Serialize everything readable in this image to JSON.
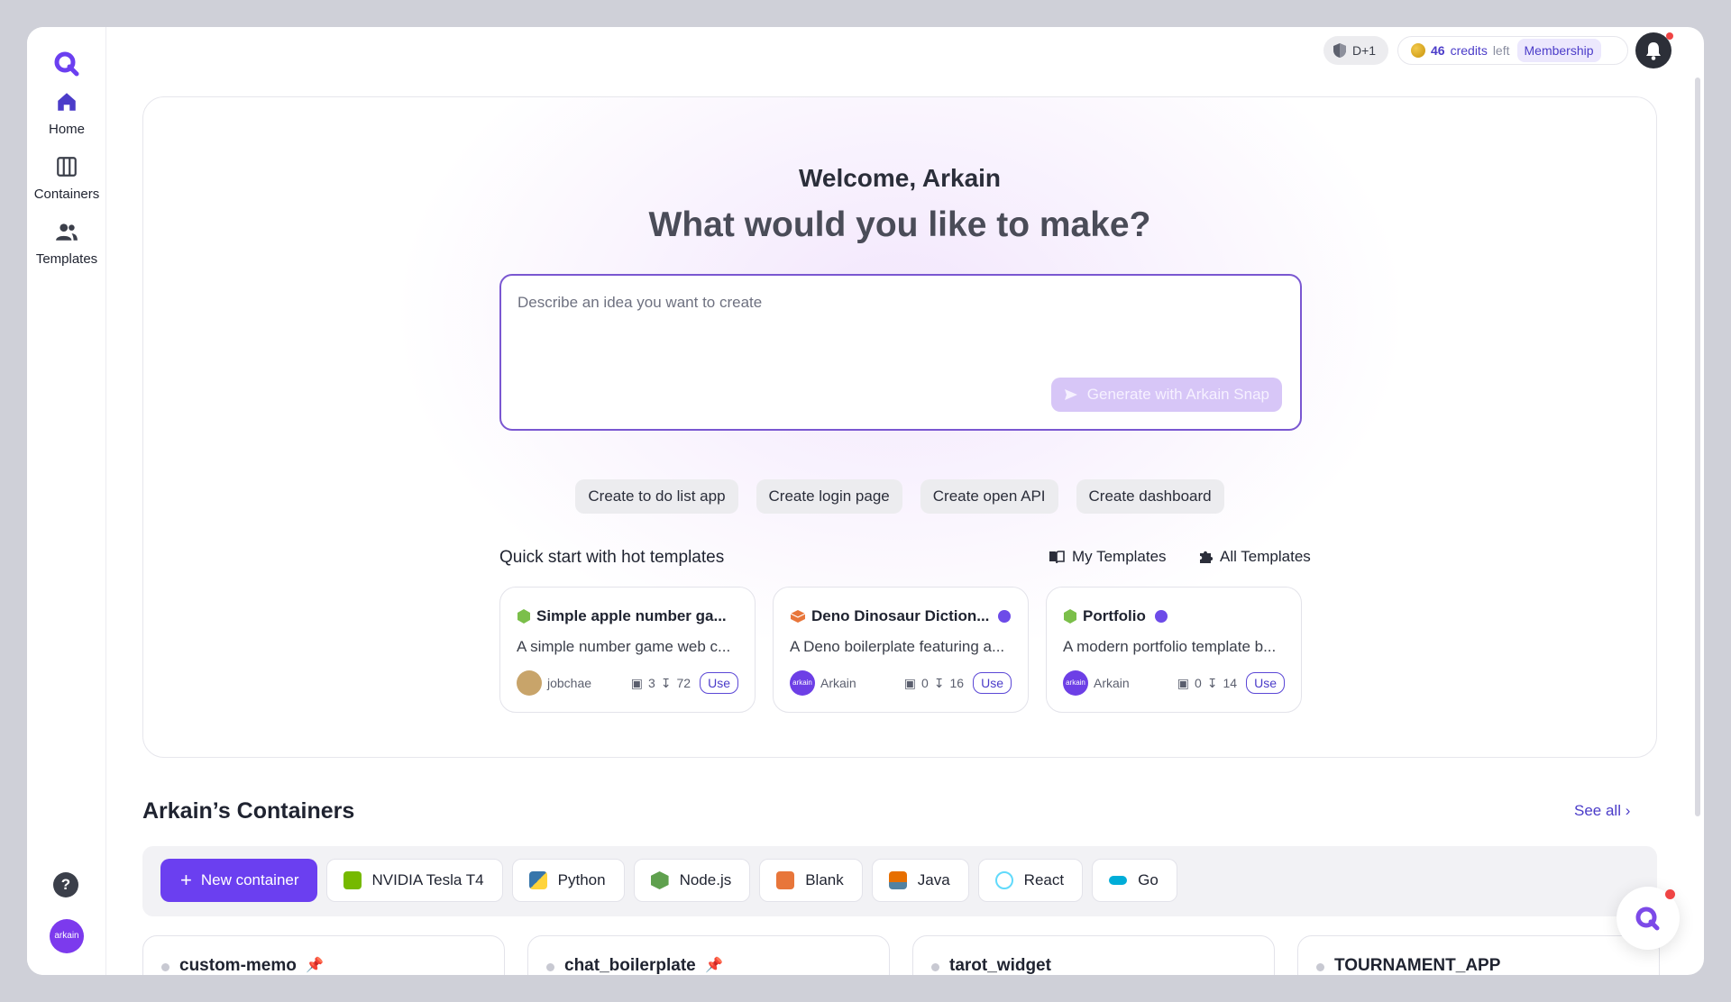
{
  "sidebar": {
    "items": [
      {
        "label": "Home",
        "icon": "home-icon"
      },
      {
        "label": "Containers",
        "icon": "containers-icon"
      },
      {
        "label": "Templates",
        "icon": "users-icon"
      }
    ],
    "help_icon": "question-icon",
    "avatar_text": "arkain"
  },
  "topbar": {
    "rank": "D+1",
    "credits_num": "46",
    "credits_word": "credits",
    "credits_left": "left",
    "membership": "Membership"
  },
  "hero": {
    "welcome": "Welcome, Arkain",
    "question": "What would you like to make?",
    "placeholder": "Describe an idea you want to create",
    "generate": "Generate with Arkain Snap",
    "chips": [
      "Create to do list app",
      "Create login page",
      "Create open API",
      "Create dashboard"
    ]
  },
  "quickstart": {
    "title": "Quick start with hot templates",
    "my_templates": "My Templates",
    "all_templates": "All Templates",
    "cards": [
      {
        "title": "Simple apple number ga...",
        "desc": "A simple number game web c...",
        "author": "jobchae",
        "comments": "3",
        "downloads": "72",
        "use": "Use",
        "verified": false,
        "icon_color": "#7bbf4a",
        "avatar_color": "#c8a46a",
        "avatar_text": ""
      },
      {
        "title": "Deno Dinosaur Diction...",
        "desc": "A Deno boilerplate featuring a...",
        "author": "Arkain",
        "comments": "0",
        "downloads": "16",
        "use": "Use",
        "verified": true,
        "icon_color": "#e8763a",
        "avatar_color": "#6d3fe6",
        "avatar_text": "arkain"
      },
      {
        "title": "Portfolio",
        "desc": "A modern portfolio template b...",
        "author": "Arkain",
        "comments": "0",
        "downloads": "14",
        "use": "Use",
        "verified": true,
        "icon_color": "#7bbf4a",
        "avatar_color": "#6d3fe6",
        "avatar_text": "arkain"
      }
    ]
  },
  "containers": {
    "title": "Arkain’s Containers",
    "see_all": "See all",
    "new_button": "New container",
    "envs": [
      {
        "label": "NVIDIA Tesla T4",
        "color": "#76b900"
      },
      {
        "label": "Python",
        "color": "#3776ab"
      },
      {
        "label": "Node.js",
        "color": "#5fa04e"
      },
      {
        "label": "Blank",
        "color": "#e8763a"
      },
      {
        "label": "Java",
        "color": "#e76f00"
      },
      {
        "label": "React",
        "color": "#61dafb"
      },
      {
        "label": "Go",
        "color": "#00add8"
      }
    ],
    "items": [
      {
        "name": "custom-memo",
        "pinned": true
      },
      {
        "name": "chat_boilerplate",
        "pinned": true
      },
      {
        "name": "tarot_widget",
        "pinned": false
      },
      {
        "name": "TOURNAMENT_APP",
        "pinned": false
      }
    ]
  },
  "colors": {
    "accent": "#6b3ff0",
    "brand": "#4b3cc9"
  }
}
